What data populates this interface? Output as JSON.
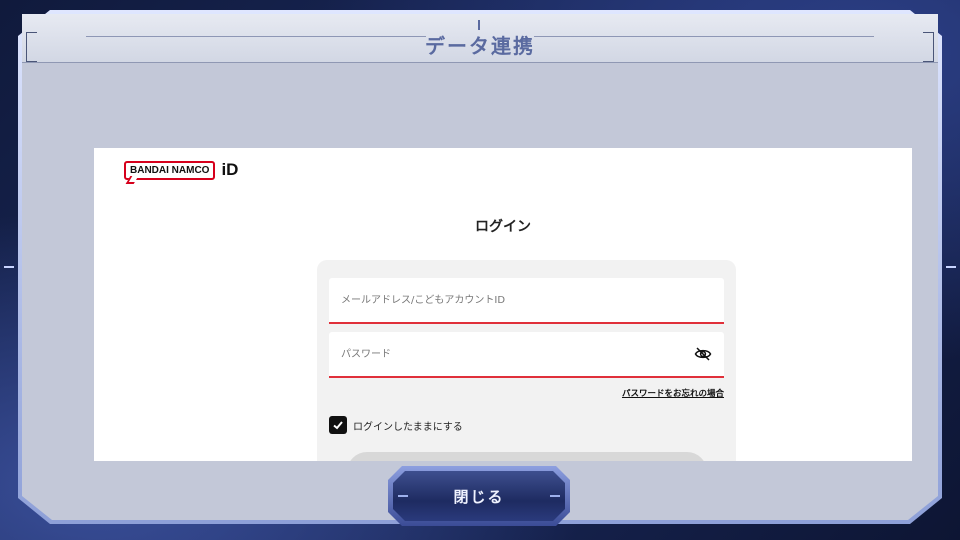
{
  "header": {
    "title": "データ連携"
  },
  "brand": {
    "logo_text": "BANDAI NAMCO",
    "logo_suffix": "iD"
  },
  "login": {
    "title": "ログイン",
    "email_placeholder": "メールアドレス/こどもアカウントID",
    "password_placeholder": "パスワード",
    "forgot_link": "パスワードをお忘れの場合",
    "remember_label": "ログインしたままにする",
    "remember_checked": true
  },
  "footer": {
    "close_label": "閉じる"
  },
  "colors": {
    "accent_red": "#e0303a",
    "brand_red": "#d6001c",
    "header_text": "#5a6aa0",
    "button_blue": "#1e2b61"
  }
}
